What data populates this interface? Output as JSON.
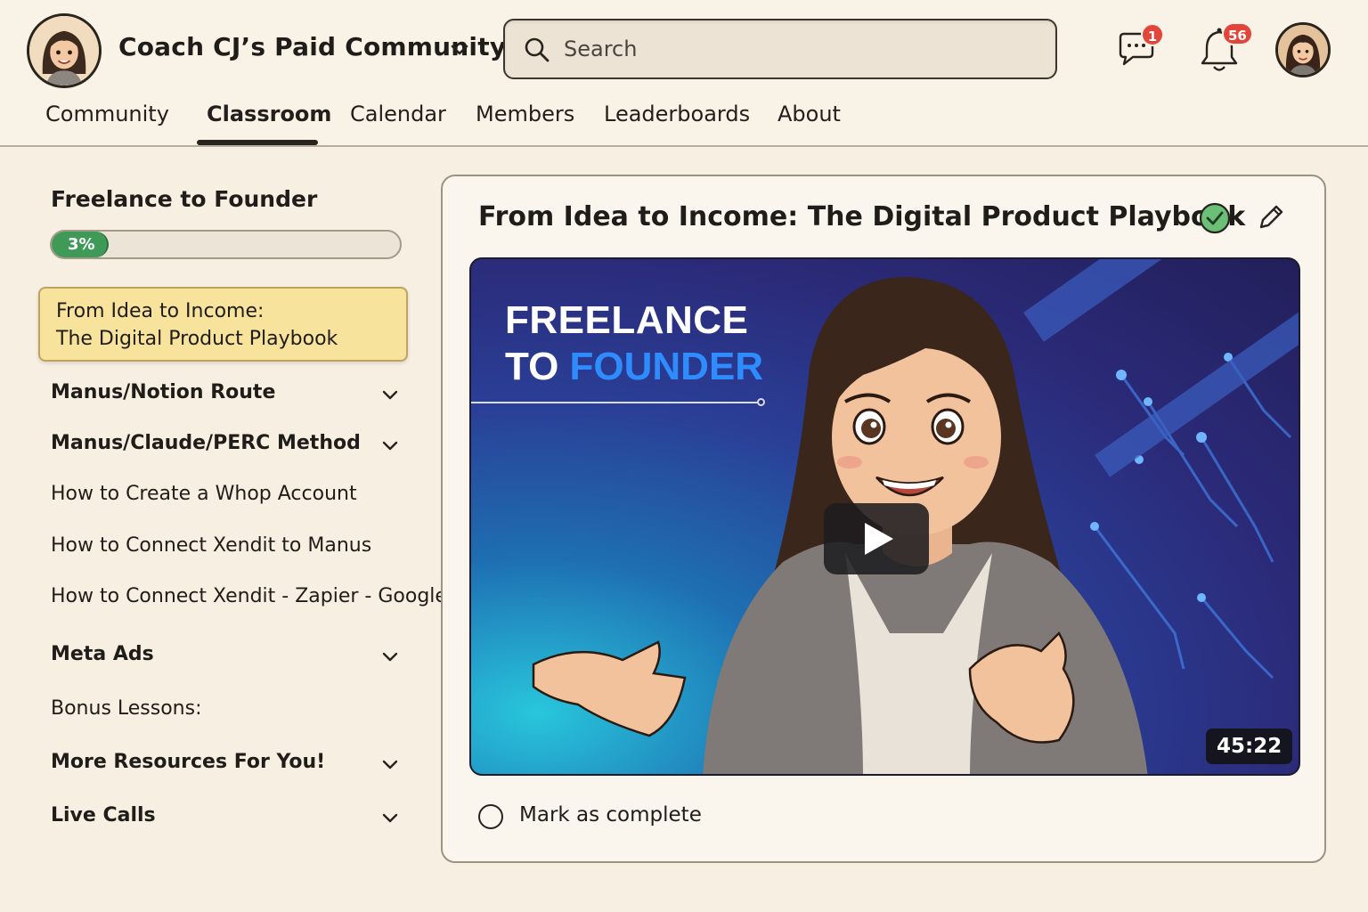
{
  "header": {
    "community_name": "Coach CJ’s Paid Community",
    "search": {
      "placeholder": "Search"
    },
    "notifications": {
      "chat_count": "1",
      "bell_count": "56"
    }
  },
  "nav": {
    "tabs": [
      {
        "label": "Community"
      },
      {
        "label": "Classroom",
        "active": true
      },
      {
        "label": "Calendar"
      },
      {
        "label": "Members"
      },
      {
        "label": "Leaderboards"
      },
      {
        "label": "About"
      }
    ]
  },
  "sidebar": {
    "course_title": "Freelance to Founder",
    "progress": {
      "percent": 3,
      "label": "3%"
    },
    "active_lesson": {
      "line1": "From Idea to Income:",
      "line2": "The Digital Product Playbook"
    },
    "items": [
      {
        "label": "Manus/Notion Route",
        "type": "section",
        "expandable": true
      },
      {
        "label": "Manus/Claude/PERC Method",
        "type": "section",
        "expandable": true
      },
      {
        "label": "How to Create a Whop Account",
        "type": "lesson"
      },
      {
        "label": "How to Connect Xendit to Manus",
        "type": "lesson"
      },
      {
        "label": "How to Connect Xendit - Zapier - Google",
        "type": "lesson"
      },
      {
        "label": "Meta Ads",
        "type": "section",
        "expandable": true
      },
      {
        "label": "Bonus Lessons:",
        "type": "lesson"
      },
      {
        "label": "More Resources For You!",
        "type": "section",
        "expandable": true
      },
      {
        "label": "Live Calls",
        "type": "section",
        "expandable": true
      }
    ]
  },
  "main": {
    "lesson_title": "From Idea to Income: The Digital Product Playbook",
    "video": {
      "thumbnail_line1": "FREELANCE",
      "thumbnail_line2_prefix": "TO ",
      "thumbnail_line2_accent": "FOUNDER",
      "duration": "45:22",
      "accent_color": "#2e8cff"
    },
    "mark_complete_label": "Mark as complete"
  },
  "colors": {
    "background": "#f7efe1",
    "active_lesson_bg": "#f8e39c",
    "progress_green": "#3f9a58",
    "badge_red": "#e2453a",
    "completed_check": "#6bbf77"
  }
}
